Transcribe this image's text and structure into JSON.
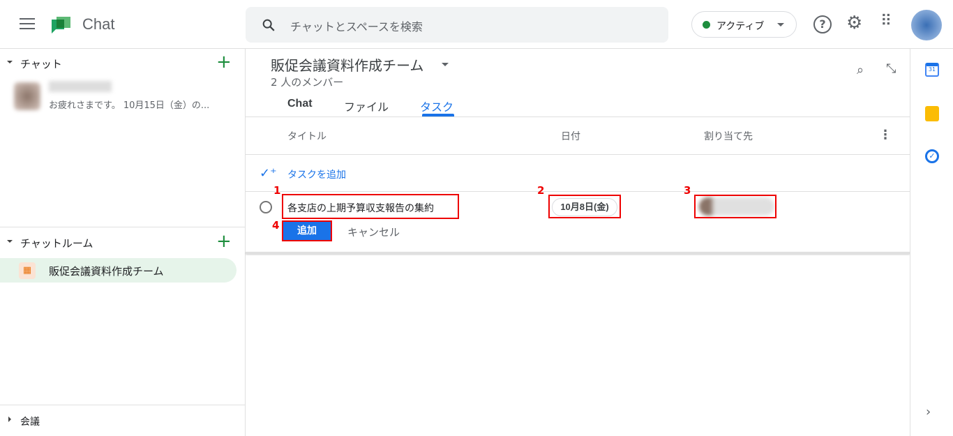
{
  "app": {
    "title": "Chat"
  },
  "search": {
    "placeholder": "チャットとスペースを検索"
  },
  "status": {
    "label": "アクティブ",
    "color": "#1e8e3e"
  },
  "sidebar": {
    "chat_section": "チャット",
    "chat_item": {
      "name": "",
      "preview": "お疲れさまです。 10月15日（金）の..."
    },
    "rooms_section": "チャットルーム",
    "room_item": "販促会議資料作成チーム",
    "meetings_section": "会議"
  },
  "room": {
    "title": "販促会議資料作成チーム",
    "members": "2 人のメンバー",
    "tabs": [
      {
        "label": "Chat"
      },
      {
        "label": "ファイル"
      },
      {
        "label": "タスク",
        "active": true
      }
    ]
  },
  "tasks": {
    "columns": [
      "タイトル",
      "日付",
      "割り当て先"
    ],
    "add_task": "タスクを追加",
    "new_task": {
      "title": "各支店の上期予算収支報告の集約",
      "date": "10月8日(金)",
      "assignee": ""
    },
    "add_button": "追加",
    "cancel_button": "キャンセル"
  },
  "annotations": [
    "1",
    "2",
    "3",
    "4"
  ],
  "accent": "#1a73e8"
}
